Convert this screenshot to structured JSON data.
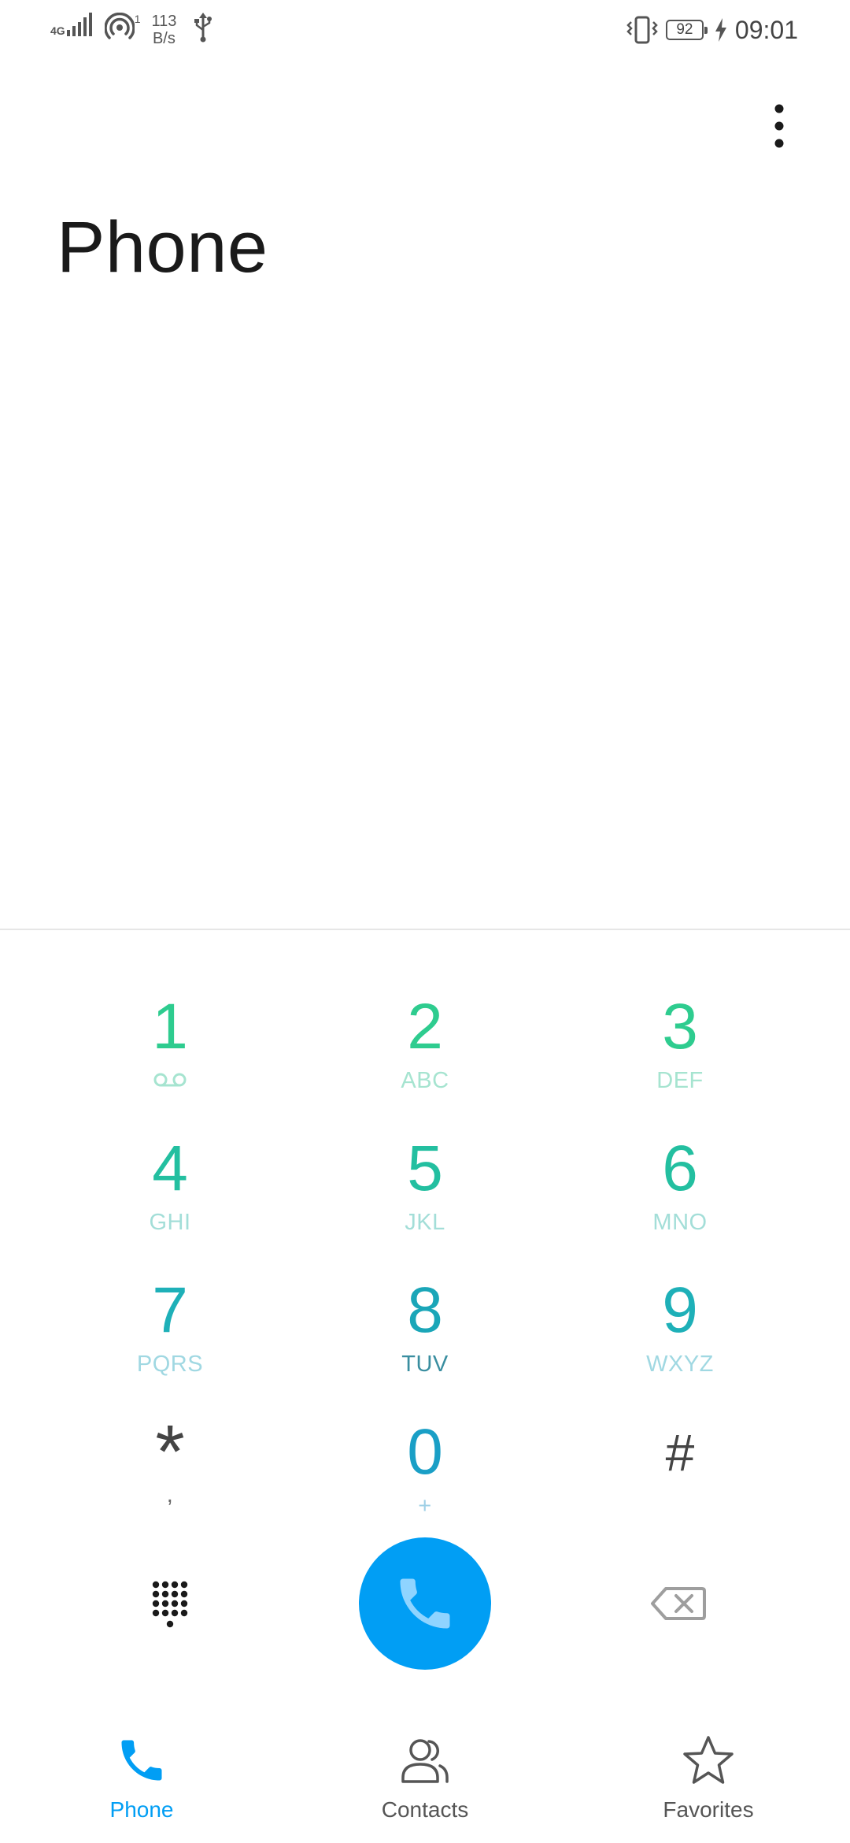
{
  "status_bar": {
    "network_type": "4G",
    "hotspot_count": "1",
    "speed_value": "113",
    "speed_unit": "B/s",
    "battery": "92",
    "time": "09:01"
  },
  "header": {
    "title": "Phone"
  },
  "dialpad": {
    "keys": [
      {
        "digit": "1",
        "sub": ""
      },
      {
        "digit": "2",
        "sub": "ABC"
      },
      {
        "digit": "3",
        "sub": "DEF"
      },
      {
        "digit": "4",
        "sub": "GHI"
      },
      {
        "digit": "5",
        "sub": "JKL"
      },
      {
        "digit": "6",
        "sub": "MNO"
      },
      {
        "digit": "7",
        "sub": "PQRS"
      },
      {
        "digit": "8",
        "sub": "TUV"
      },
      {
        "digit": "9",
        "sub": "WXYZ"
      },
      {
        "digit": "*",
        "sub": ","
      },
      {
        "digit": "0",
        "sub": "+"
      },
      {
        "digit": "#",
        "sub": ""
      }
    ]
  },
  "bottom_nav": {
    "items": [
      {
        "label": "Phone",
        "icon": "phone-icon",
        "active": true
      },
      {
        "label": "Contacts",
        "icon": "contacts-icon",
        "active": false
      },
      {
        "label": "Favorites",
        "icon": "star-icon",
        "active": false
      }
    ]
  },
  "colors": {
    "accent": "#019ef4",
    "digit_green": "#2ecc8f",
    "digit_teal": "#1fb5a6",
    "digit_blue": "#1ba3c4"
  }
}
